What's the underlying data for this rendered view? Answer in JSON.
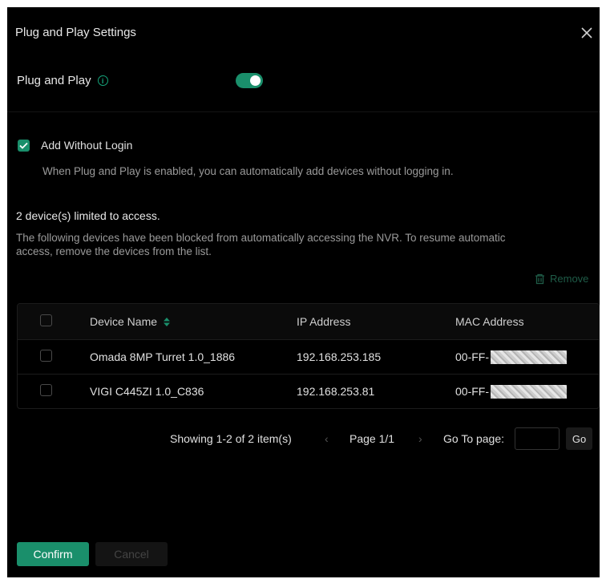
{
  "dialog": {
    "title": "Plug and Play Settings",
    "close_icon": "close-icon"
  },
  "plug_and_play": {
    "label": "Plug and Play",
    "enabled": true,
    "accent_color": "#1a8f6b"
  },
  "add_without_login": {
    "label": "Add Without Login",
    "checked": true,
    "description": "When Plug and Play is enabled, you can automatically add devices without logging in."
  },
  "blocked": {
    "heading": "2 device(s) limited to access.",
    "description": "The following devices have been blocked from automatically accessing the NVR. To resume automatic access, remove the devices from the list.",
    "remove_label": "Remove"
  },
  "table": {
    "columns": [
      "Device Name",
      "IP Address",
      "MAC Address"
    ],
    "rows": [
      {
        "name": "Omada 8MP Turret 1.0_1886",
        "ip": "192.168.253.185",
        "mac_prefix": "00-FF-"
      },
      {
        "name": "VIGI C445ZI 1.0_C836",
        "ip": "192.168.253.81",
        "mac_prefix": "00-FF-"
      }
    ]
  },
  "pager": {
    "showing": "Showing 1-2 of 2 item(s)",
    "prev": "‹",
    "page_info": "Page 1/1",
    "next": "›",
    "goto_label": "Go To page:",
    "goto_value": "",
    "go_label": "Go"
  },
  "buttons": {
    "confirm": "Confirm",
    "cancel": "Cancel"
  }
}
